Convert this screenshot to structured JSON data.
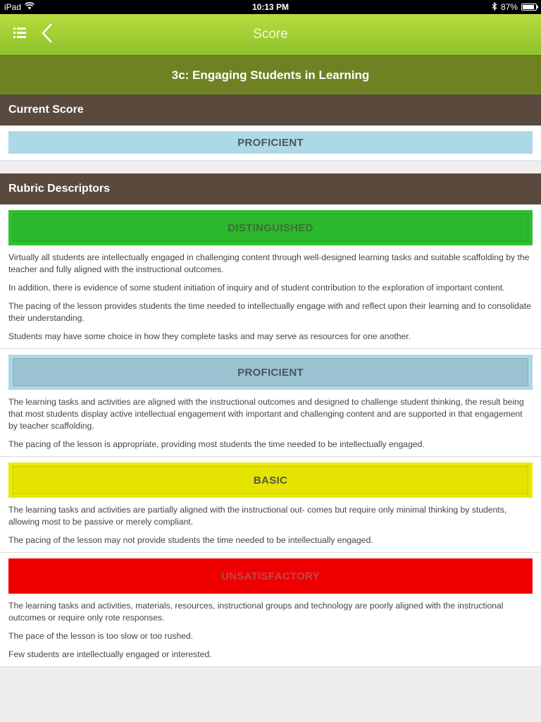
{
  "status_bar": {
    "device": "iPad",
    "time": "10:13 PM",
    "battery": "87%",
    "battery_level": 0.87
  },
  "nav": {
    "title": "Score",
    "list_icon": "list-icon",
    "back_icon": "chevron-left-icon"
  },
  "section_title": "3c: Engaging Students in Learning",
  "current_score": {
    "header": "Current Score",
    "value": "PROFICIENT"
  },
  "rubric": {
    "header": "Rubric Descriptors",
    "levels": [
      {
        "label": "DISTINGUISHED",
        "descriptors": [
          "Virtually all students are intellectually engaged in challenging content through well-designed learning tasks and suitable scaffolding by the teacher and fully aligned with the instructional outcomes.",
          "In addition, there is evidence of some student initiation of inquiry and of student contribution to the exploration of important content.",
          "The pacing of the lesson provides students the time needed to intellectually engage with and reflect upon their learning and to consolidate their understanding.",
          "Students may have some choice in how they complete tasks and may serve as resources for one another."
        ]
      },
      {
        "label": "PROFICIENT",
        "descriptors": [
          "The learning tasks and activities are aligned with the instructional outcomes and designed to challenge student thinking, the result being that most students display active intellectual engagement with important and challenging content and are supported in that engagement by teacher scaffolding.",
          "The pacing of the lesson is appropriate, providing most students the time needed to be intellectually engaged."
        ]
      },
      {
        "label": "BASIC",
        "descriptors": [
          "The learning tasks and activities are partially aligned with the instructional out- comes but require only minimal thinking by students, allowing most to be passive or merely compliant.",
          "The pacing of the lesson may not provide students the time needed to be intellectually engaged."
        ]
      },
      {
        "label": "UNSATISFACTORY",
        "descriptors": [
          "The learning tasks and activities, materials, resources, instructional groups and technology are poorly aligned with the instructional outcomes or require only rote responses.",
          "The pace of the lesson is too slow or too rushed.",
          "Few students are intellectually engaged or interested."
        ]
      }
    ]
  },
  "colors": {
    "nav_green": "#9ccb33",
    "section_olive": "#6e8223",
    "header_brown": "#5a4a3e",
    "proficient_blue": "#add8e6",
    "distinguished_green": "#2fbf2f",
    "basic_yellow": "#eaea00",
    "unsatisfactory_red": "#ee0000"
  }
}
